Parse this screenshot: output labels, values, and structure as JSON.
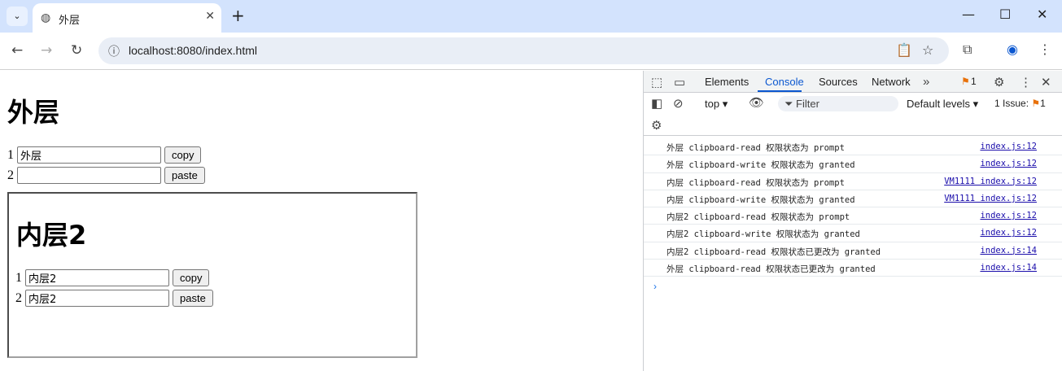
{
  "browser": {
    "tab_title": "外层",
    "url": "localhost:8080/index.html"
  },
  "page": {
    "heading": "外层",
    "rows": [
      {
        "num": "1",
        "value": "外层",
        "button": "copy"
      },
      {
        "num": "2",
        "value": "",
        "button": "paste"
      }
    ],
    "iframe": {
      "heading": "内层2",
      "rows": [
        {
          "num": "1",
          "value": "内层2",
          "button": "copy"
        },
        {
          "num": "2",
          "value": "内层2",
          "button": "paste"
        }
      ]
    }
  },
  "devtools": {
    "tabs": [
      "Elements",
      "Console",
      "Sources",
      "Network"
    ],
    "active_tab": "Console",
    "issues_badge": "1",
    "context": "top",
    "filter_placeholder": "Filter",
    "levels": "Default levels",
    "issue_count": "1 Issue:",
    "issue_num": "1",
    "logs": [
      {
        "msg": "外层 clipboard-read 权限状态为 prompt",
        "src": "index.js:12"
      },
      {
        "msg": "外层 clipboard-write 权限状态为 granted",
        "src": "index.js:12"
      },
      {
        "msg": "内层 clipboard-read 权限状态为 prompt",
        "src": "VM1111 index.js:12"
      },
      {
        "msg": "内层 clipboard-write 权限状态为 granted",
        "src": "VM1111 index.js:12"
      },
      {
        "msg": "内层2 clipboard-read 权限状态为 prompt",
        "src": "index.js:12"
      },
      {
        "msg": "内层2 clipboard-write 权限状态为 granted",
        "src": "index.js:12"
      },
      {
        "msg": "内层2 clipboard-read 权限状态已更改为 granted",
        "src": "index.js:14"
      },
      {
        "msg": "外层 clipboard-read 权限状态已更改为 granted",
        "src": "index.js:14"
      }
    ]
  }
}
